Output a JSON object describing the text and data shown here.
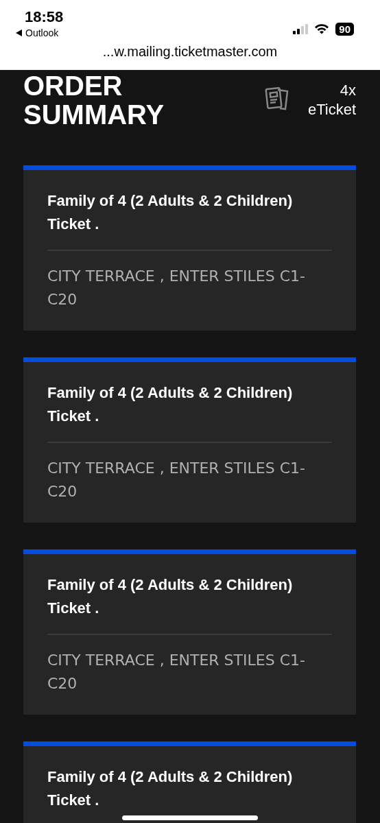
{
  "status_bar": {
    "time": "18:58",
    "back_label": "Outlook",
    "battery": "90"
  },
  "address_bar": {
    "url": "...w.mailing.ticketmaster.com"
  },
  "header": {
    "title": "ORDER SUMMARY",
    "ticket_count": "4x",
    "ticket_type": "eTicket"
  },
  "tickets": [
    {
      "title": "Family of 4 (2 Adults & 2 Children) Ticket .",
      "venue": "CITY TERRACE , ENTER STILES C1-C20"
    },
    {
      "title": "Family of 4 (2 Adults & 2 Children) Ticket .",
      "venue": "CITY TERRACE , ENTER STILES C1-C20"
    },
    {
      "title": "Family of 4 (2 Adults & 2 Children) Ticket .",
      "venue": "CITY TERRACE , ENTER STILES C1-C20"
    },
    {
      "title": "Family of 4 (2 Adults & 2 Children) Ticket ."
    }
  ]
}
